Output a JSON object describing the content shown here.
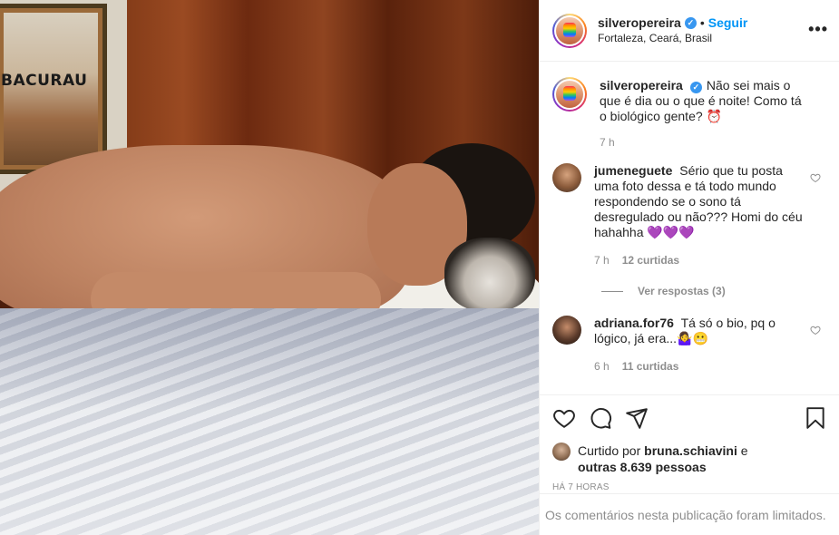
{
  "photo": {
    "poster_title": "BACURAU"
  },
  "header": {
    "username": "silveropereira",
    "separator": "•",
    "follow_label": "Seguir",
    "location": "Fortaleza, Ceará, Brasil",
    "more_label": "•••"
  },
  "caption": {
    "author": "silveropereira",
    "text": "Não sei mais o que é dia ou o que é noite! Como tá o biológico gente? ⏰",
    "time": "7 h"
  },
  "comments": [
    {
      "author": "jumeneguete",
      "text": "Sério que tu posta uma foto dessa e tá todo mundo respondendo se o sono tá desregulado ou não??? Homi do céu hahahha 💜💜💜",
      "time": "7 h",
      "likes": "12 curtidas",
      "view_replies": "Ver respostas (3)"
    },
    {
      "author": "adriana.for76",
      "text": "Tá só o bio, pq o lógico, já era...🤷‍♀️😬",
      "time": "6 h",
      "likes": "11 curtidas"
    }
  ],
  "likes_summary": {
    "prefix": "Curtido por",
    "liker": "bruna.schiavini",
    "joiner": "e",
    "others": "outras 8.639 pessoas"
  },
  "timestamp": "HÁ 7 HORAS",
  "comments_limited": "Os comentários nesta publicação foram limitados.",
  "icons": [
    "heart-icon",
    "comment-icon",
    "share-icon",
    "bookmark-icon",
    "verified-badge-icon",
    "more-icon"
  ],
  "colors": {
    "link_blue": "#0095f6",
    "verified_blue": "#3897f0",
    "text_primary": "#262626",
    "text_secondary": "#8e8e8e",
    "divider": "#efefef"
  }
}
